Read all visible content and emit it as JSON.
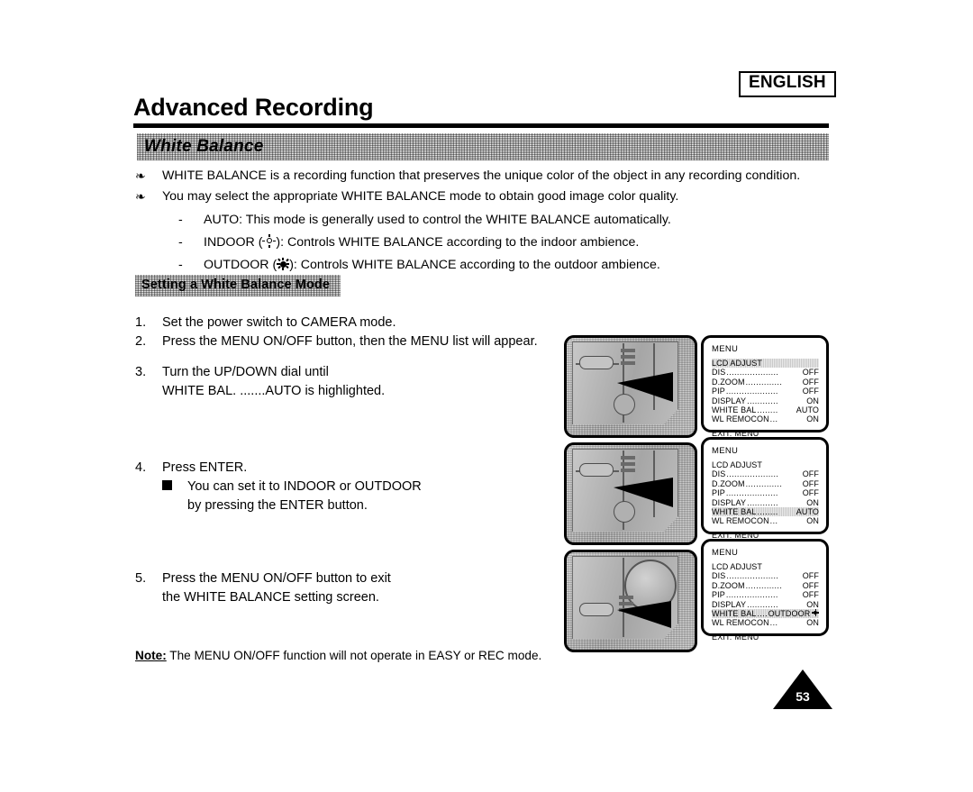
{
  "header": {
    "language_badge": "ENGLISH",
    "chapter_title": "Advanced Recording",
    "section_title": "White Balance"
  },
  "intro": {
    "bullets": [
      "WHITE BALANCE is a recording function that preserves the unique color of the object in any recording condition.",
      "You may select the appropriate WHITE BALANCE mode to obtain good image color quality."
    ],
    "modes": [
      {
        "dash": "-",
        "text": "AUTO: This mode is generally used to control the WHITE BALANCE automatically.",
        "icon": ""
      },
      {
        "dash": "-",
        "prefix": "INDOOR (",
        "suffix": "): Controls WHITE BALANCE according to the indoor ambience.",
        "icon": "indoor-lamp-icon"
      },
      {
        "dash": "-",
        "prefix": "OUTDOOR (",
        "suffix": "): Controls WHITE BALANCE according to the outdoor ambience.",
        "icon": "outdoor-sun-icon"
      }
    ]
  },
  "subsection_title": "Setting a White Balance Mode",
  "steps": [
    {
      "num": "1.",
      "lines": [
        "Set the power switch to CAMERA mode."
      ]
    },
    {
      "num": "2.",
      "lines": [
        "Press the MENU ON/OFF button, then the MENU list will appear."
      ]
    },
    {
      "num": "3.",
      "lines": [
        "Turn the UP/DOWN dial until",
        "WHITE BAL. .......AUTO is highlighted."
      ]
    },
    {
      "num": "4.",
      "lines": [
        "Press ENTER."
      ],
      "sub": [
        "You can set it to INDOOR or OUTDOOR",
        "by pressing the ENTER button."
      ]
    },
    {
      "num": "5.",
      "lines": [
        "Press the MENU ON/OFF button to exit",
        "the WHITE BALANCE setting screen."
      ]
    }
  ],
  "note": {
    "label": "Note:",
    "text": "The MENU ON/OFF function will not operate in EASY or REC mode."
  },
  "page_number": "53",
  "menu_screens": [
    {
      "title": "MENU",
      "highlight": "LCD ADJUST",
      "rows": [
        {
          "label": "LCD ADJUST",
          "dots": "",
          "value": ""
        },
        {
          "label": "DIS",
          "dots": "....................",
          "value": "OFF"
        },
        {
          "label": "D.ZOOM",
          "dots": "..............",
          "value": "OFF"
        },
        {
          "label": "PIP",
          "dots": "....................",
          "value": "OFF"
        },
        {
          "label": "DISPLAY",
          "dots": "............",
          "value": "ON"
        },
        {
          "label": "WHITE BAL",
          "dots": "........",
          "value": "AUTO"
        },
        {
          "label": "WL REMOCON",
          "dots": "...",
          "value": "ON"
        }
      ],
      "exit": "EXIT: MENU"
    },
    {
      "title": "MENU",
      "highlight": "WHITE BAL",
      "rows": [
        {
          "label": "LCD ADJUST",
          "dots": "",
          "value": ""
        },
        {
          "label": "DIS",
          "dots": "....................",
          "value": "OFF"
        },
        {
          "label": "D.ZOOM",
          "dots": "..............",
          "value": "OFF"
        },
        {
          "label": "PIP",
          "dots": "....................",
          "value": "OFF"
        },
        {
          "label": "DISPLAY",
          "dots": "............",
          "value": "ON"
        },
        {
          "label": "WHITE BAL",
          "dots": "........",
          "value": "AUTO"
        },
        {
          "label": "WL REMOCON",
          "dots": "...",
          "value": "ON"
        }
      ],
      "exit": "EXIT: MENU"
    },
    {
      "title": "MENU",
      "highlight": "WHITE BAL",
      "rows": [
        {
          "label": "LCD ADJUST",
          "dots": "",
          "value": ""
        },
        {
          "label": "DIS",
          "dots": "....................",
          "value": "OFF"
        },
        {
          "label": "D.ZOOM",
          "dots": "..............",
          "value": "OFF"
        },
        {
          "label": "PIP",
          "dots": "....................",
          "value": "OFF"
        },
        {
          "label": "DISPLAY",
          "dots": "............",
          "value": "ON"
        },
        {
          "label": "WHITE BAL",
          "dots": "....",
          "value": "OUTDOOR",
          "value_icon": "sun-icon"
        },
        {
          "label": "WL REMOCON",
          "dots": "...",
          "value": "ON"
        }
      ],
      "exit": "EXIT: MENU"
    }
  ],
  "photos": [
    {
      "caption_alt": "camcorder-menu-button-photo-1"
    },
    {
      "caption_alt": "camcorder-menu-button-photo-2"
    },
    {
      "caption_alt": "camcorder-enter-dial-photo-3"
    }
  ],
  "colors": {
    "ink": "#000000",
    "band": "#d6d6d6",
    "photo": "#b4b4b4"
  }
}
